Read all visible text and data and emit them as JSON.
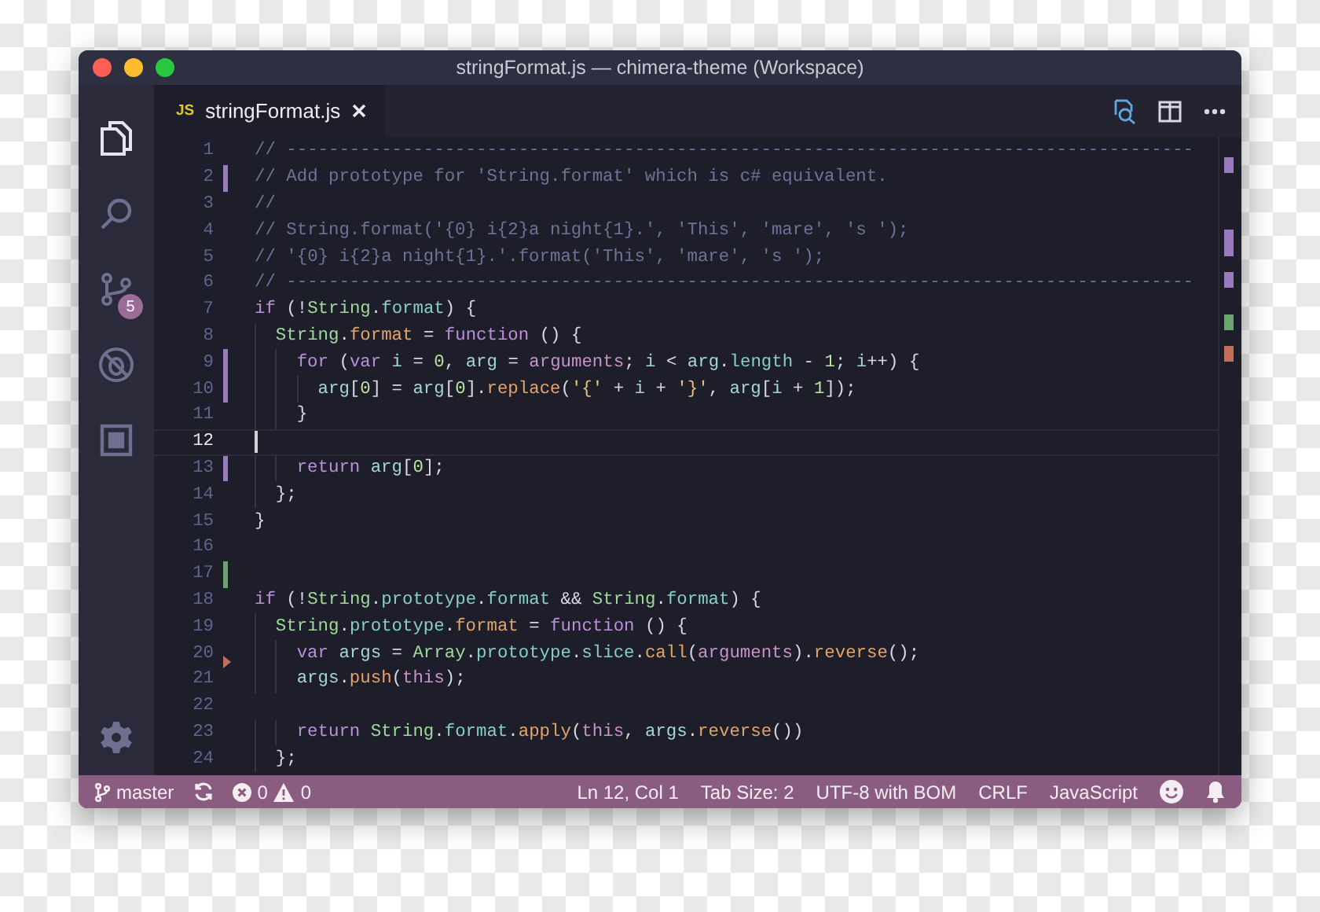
{
  "window": {
    "title": "stringFormat.js — chimera-theme (Workspace)"
  },
  "activity_bar": [
    {
      "kind": "files",
      "selected": true
    },
    {
      "kind": "search",
      "selected": false
    },
    {
      "kind": "source-control",
      "selected": false,
      "badge": "5"
    },
    {
      "kind": "debug",
      "selected": false
    },
    {
      "kind": "extensions",
      "selected": false
    },
    {
      "kind": "settings",
      "selected": false
    }
  ],
  "tabs": [
    {
      "badge": "JS",
      "label": "stringFormat.js",
      "selected": true
    }
  ],
  "editor": {
    "lines": [
      {
        "number": "1",
        "kind": "plain",
        "current": false,
        "tokens": [
          {
            "kind": "comment",
            "text": "// --------------------------------------------------------------------------------------"
          }
        ]
      },
      {
        "number": "2",
        "kind": "modified",
        "current": false,
        "tokens": [
          {
            "kind": "comment",
            "text": "// Add prototype for 'String.format' which is c# equivalent."
          }
        ]
      },
      {
        "number": "3",
        "kind": "plain",
        "current": false,
        "tokens": [
          {
            "kind": "comment",
            "text": "//"
          }
        ]
      },
      {
        "number": "4",
        "kind": "plain",
        "current": false,
        "tokens": [
          {
            "kind": "comment",
            "text": "// String.format('{0} i{2}a night{1}.', 'This', 'mare', 's ');"
          }
        ]
      },
      {
        "number": "5",
        "kind": "plain",
        "current": false,
        "tokens": [
          {
            "kind": "comment",
            "text": "// '{0} i{2}a night{1}.'.format('This', 'mare', 's ');"
          }
        ]
      },
      {
        "number": "6",
        "kind": "plain",
        "current": false,
        "tokens": [
          {
            "kind": "comment",
            "text": "// --------------------------------------------------------------------------------------"
          }
        ]
      },
      {
        "number": "7",
        "kind": "plain",
        "current": false,
        "tokens": [
          {
            "kind": "keyword",
            "text": "if"
          },
          {
            "kind": "plain",
            "text": " (!"
          },
          {
            "kind": "class",
            "text": "String"
          },
          {
            "kind": "plain",
            "text": "."
          },
          {
            "kind": "property",
            "text": "format"
          },
          {
            "kind": "plain",
            "text": ") {"
          }
        ]
      },
      {
        "number": "8",
        "kind": "plain",
        "current": false,
        "tokens": [
          {
            "kind": "class",
            "text": "  String"
          },
          {
            "kind": "plain",
            "text": "."
          },
          {
            "kind": "method",
            "text": "format"
          },
          {
            "kind": "plain",
            "text": " = "
          },
          {
            "kind": "keyword",
            "text": "function"
          },
          {
            "kind": "plain",
            "text": " () {"
          }
        ]
      },
      {
        "number": "9",
        "kind": "modified",
        "current": false,
        "tokens": [
          {
            "kind": "keyword",
            "text": "    for"
          },
          {
            "kind": "plain",
            "text": " ("
          },
          {
            "kind": "keyword",
            "text": "var "
          },
          {
            "kind": "variable",
            "text": "i"
          },
          {
            "kind": "plain",
            "text": " = "
          },
          {
            "kind": "number",
            "text": "0"
          },
          {
            "kind": "plain",
            "text": ", "
          },
          {
            "kind": "variable",
            "text": "arg"
          },
          {
            "kind": "plain",
            "text": " = "
          },
          {
            "kind": "builtin",
            "text": "arguments"
          },
          {
            "kind": "plain",
            "text": "; "
          },
          {
            "kind": "variable",
            "text": "i"
          },
          {
            "kind": "plain",
            "text": " < "
          },
          {
            "kind": "variable",
            "text": "arg"
          },
          {
            "kind": "plain",
            "text": "."
          },
          {
            "kind": "property",
            "text": "length"
          },
          {
            "kind": "plain",
            "text": " - "
          },
          {
            "kind": "number",
            "text": "1"
          },
          {
            "kind": "plain",
            "text": "; "
          },
          {
            "kind": "variable",
            "text": "i"
          },
          {
            "kind": "plain",
            "text": "++) {"
          }
        ]
      },
      {
        "number": "10",
        "kind": "modified",
        "current": false,
        "tokens": [
          {
            "kind": "variable",
            "text": "      arg"
          },
          {
            "kind": "plain",
            "text": "["
          },
          {
            "kind": "number",
            "text": "0"
          },
          {
            "kind": "plain",
            "text": "] = "
          },
          {
            "kind": "variable",
            "text": "arg"
          },
          {
            "kind": "plain",
            "text": "["
          },
          {
            "kind": "number",
            "text": "0"
          },
          {
            "kind": "plain",
            "text": "]."
          },
          {
            "kind": "method",
            "text": "replace"
          },
          {
            "kind": "plain",
            "text": "("
          },
          {
            "kind": "string",
            "text": "'{'"
          },
          {
            "kind": "plain",
            "text": " + "
          },
          {
            "kind": "variable",
            "text": "i"
          },
          {
            "kind": "plain",
            "text": " + "
          },
          {
            "kind": "string",
            "text": "'}'"
          },
          {
            "kind": "plain",
            "text": ", "
          },
          {
            "kind": "variable",
            "text": "arg"
          },
          {
            "kind": "plain",
            "text": "["
          },
          {
            "kind": "variable",
            "text": "i"
          },
          {
            "kind": "plain",
            "text": " + "
          },
          {
            "kind": "number",
            "text": "1"
          },
          {
            "kind": "plain",
            "text": "]);"
          }
        ]
      },
      {
        "number": "11",
        "kind": "plain",
        "current": false,
        "tokens": [
          {
            "kind": "plain",
            "text": "    }"
          }
        ]
      },
      {
        "number": "12",
        "kind": "plain",
        "current": true
      },
      {
        "number": "13",
        "kind": "modified",
        "current": false,
        "tokens": [
          {
            "kind": "keyword",
            "text": "    return "
          },
          {
            "kind": "variable",
            "text": "arg"
          },
          {
            "kind": "plain",
            "text": "["
          },
          {
            "kind": "number",
            "text": "0"
          },
          {
            "kind": "plain",
            "text": "];"
          }
        ]
      },
      {
        "number": "14",
        "kind": "plain",
        "current": false,
        "tokens": [
          {
            "kind": "plain",
            "text": "  };"
          }
        ]
      },
      {
        "number": "15",
        "kind": "plain",
        "current": false,
        "tokens": [
          {
            "kind": "plain",
            "text": "}"
          }
        ]
      },
      {
        "number": "16",
        "kind": "plain",
        "current": false
      },
      {
        "number": "17",
        "kind": "added",
        "current": false
      },
      {
        "number": "18",
        "kind": "plain",
        "current": false,
        "tokens": [
          {
            "kind": "keyword",
            "text": "if"
          },
          {
            "kind": "plain",
            "text": " (!"
          },
          {
            "kind": "class",
            "text": "String"
          },
          {
            "kind": "plain",
            "text": "."
          },
          {
            "kind": "property",
            "text": "prototype"
          },
          {
            "kind": "plain",
            "text": "."
          },
          {
            "kind": "property",
            "text": "format"
          },
          {
            "kind": "plain",
            "text": " && "
          },
          {
            "kind": "class",
            "text": "String"
          },
          {
            "kind": "plain",
            "text": "."
          },
          {
            "kind": "property",
            "text": "format"
          },
          {
            "kind": "plain",
            "text": ") {"
          }
        ]
      },
      {
        "number": "19",
        "kind": "plain",
        "current": false,
        "tokens": [
          {
            "kind": "class",
            "text": "  String"
          },
          {
            "kind": "plain",
            "text": "."
          },
          {
            "kind": "property",
            "text": "prototype"
          },
          {
            "kind": "plain",
            "text": "."
          },
          {
            "kind": "method",
            "text": "format"
          },
          {
            "kind": "plain",
            "text": " = "
          },
          {
            "kind": "keyword",
            "text": "function"
          },
          {
            "kind": "plain",
            "text": " () {"
          }
        ]
      },
      {
        "number": "20",
        "kind": "deleted",
        "current": false,
        "tokens": [
          {
            "kind": "keyword",
            "text": "    var "
          },
          {
            "kind": "variable",
            "text": "args"
          },
          {
            "kind": "plain",
            "text": " = "
          },
          {
            "kind": "class",
            "text": "Array"
          },
          {
            "kind": "plain",
            "text": "."
          },
          {
            "kind": "property",
            "text": "prototype"
          },
          {
            "kind": "plain",
            "text": "."
          },
          {
            "kind": "property",
            "text": "slice"
          },
          {
            "kind": "plain",
            "text": "."
          },
          {
            "kind": "method",
            "text": "call"
          },
          {
            "kind": "plain",
            "text": "("
          },
          {
            "kind": "builtin",
            "text": "arguments"
          },
          {
            "kind": "plain",
            "text": ")."
          },
          {
            "kind": "method",
            "text": "reverse"
          },
          {
            "kind": "plain",
            "text": "();"
          }
        ]
      },
      {
        "number": "21",
        "kind": "plain",
        "current": false,
        "tokens": [
          {
            "kind": "variable",
            "text": "    args"
          },
          {
            "kind": "plain",
            "text": "."
          },
          {
            "kind": "method",
            "text": "push"
          },
          {
            "kind": "plain",
            "text": "("
          },
          {
            "kind": "builtin",
            "text": "this"
          },
          {
            "kind": "plain",
            "text": ");"
          }
        ]
      },
      {
        "number": "22",
        "kind": "plain",
        "current": false
      },
      {
        "number": "23",
        "kind": "plain",
        "current": false,
        "tokens": [
          {
            "kind": "keyword",
            "text": "    return "
          },
          {
            "kind": "class",
            "text": "String"
          },
          {
            "kind": "plain",
            "text": "."
          },
          {
            "kind": "property",
            "text": "format"
          },
          {
            "kind": "plain",
            "text": "."
          },
          {
            "kind": "method",
            "text": "apply"
          },
          {
            "kind": "plain",
            "text": "("
          },
          {
            "kind": "builtin",
            "text": "this"
          },
          {
            "kind": "plain",
            "text": ", "
          },
          {
            "kind": "variable",
            "text": "args"
          },
          {
            "kind": "plain",
            "text": "."
          },
          {
            "kind": "method",
            "text": "reverse"
          },
          {
            "kind": "plain",
            "text": "())"
          }
        ]
      },
      {
        "number": "24",
        "kind": "plain",
        "current": false,
        "tokens": [
          {
            "kind": "plain",
            "text": "  };"
          }
        ]
      }
    ]
  },
  "status_bar": {
    "branch": "master",
    "errors": "0",
    "warnings": "0",
    "items": [
      "Ln 12, Col 1",
      "Tab Size: 2",
      "UTF-8 with BOM",
      "CRLF",
      "JavaScript"
    ]
  }
}
